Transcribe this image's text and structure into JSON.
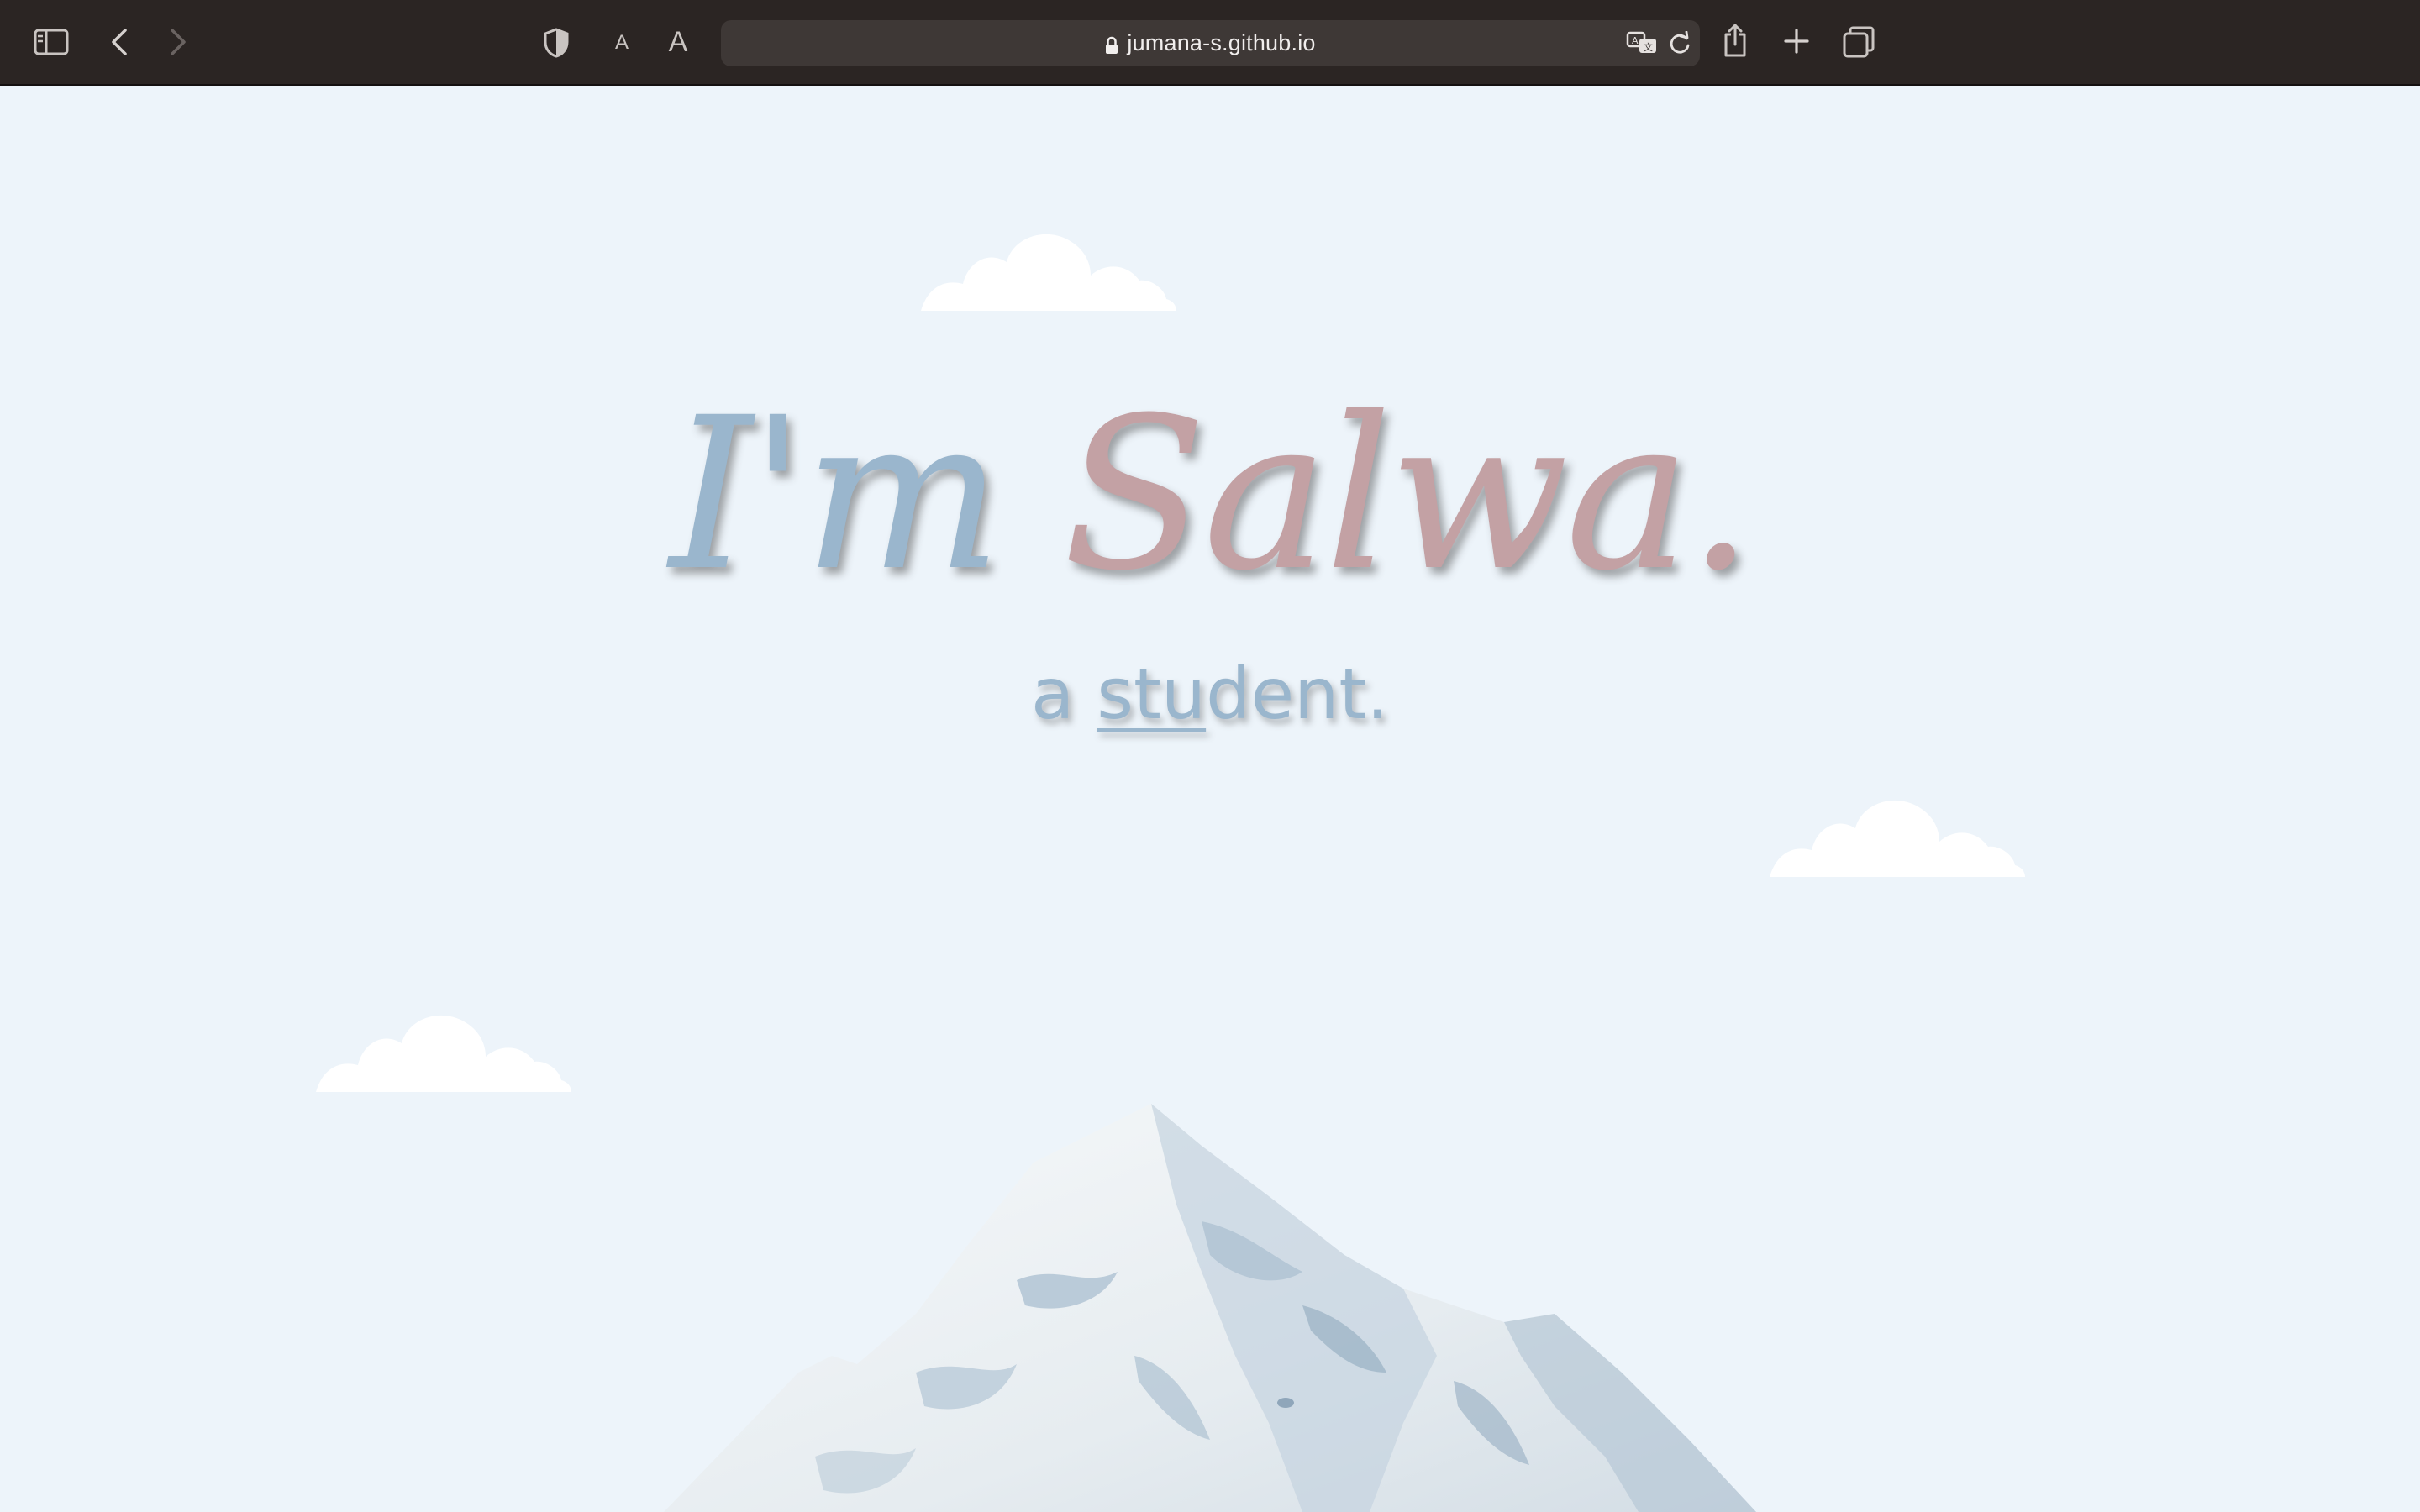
{
  "browser": {
    "url": "jumana-s.github.io",
    "text_size_small": "A",
    "text_size_large": "A",
    "icons": {
      "sidebar": "sidebar-icon",
      "back": "chevron-left-icon",
      "forward": "chevron-right-icon",
      "privacy": "shield-icon",
      "lock": "lock-icon",
      "translate": "translate-icon",
      "reload": "reload-icon",
      "share": "share-icon",
      "new_tab": "plus-icon",
      "tabs": "tab-overview-icon"
    }
  },
  "hero": {
    "headline_part1": "I'm",
    "headline_part2": "Salwa.",
    "subline_prefix": "a",
    "subline_typed": "stu",
    "subline_rest": "dent.",
    "colors": {
      "background": "#edf4fa",
      "blue": "#9ab6cd",
      "rose": "#c3a1a4"
    }
  }
}
